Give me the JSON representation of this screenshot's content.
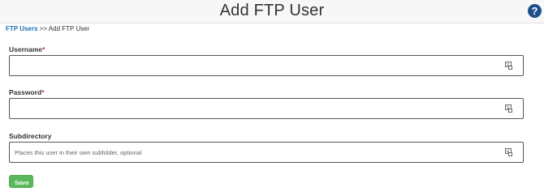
{
  "header": {
    "title": "Add FTP User",
    "help_icon": "question-circle-icon",
    "help_glyph": "?",
    "help_color": "#1f4e8c"
  },
  "breadcrumb": {
    "parent": "FTP Users",
    "separator": ">>",
    "current": "Add FTP User"
  },
  "form": {
    "username": {
      "label": "Username",
      "required_marker": "*",
      "value": "",
      "placeholder": ""
    },
    "password": {
      "label": "Password",
      "required_marker": "*",
      "value": "",
      "placeholder": ""
    },
    "subdirectory": {
      "label": "Subdirectory",
      "value": "",
      "placeholder": "Places this user in their own subfolder, optional"
    },
    "field_icon": "keyboard-icon"
  },
  "actions": {
    "save_label": "Save",
    "save_color": "#5cb85c"
  }
}
